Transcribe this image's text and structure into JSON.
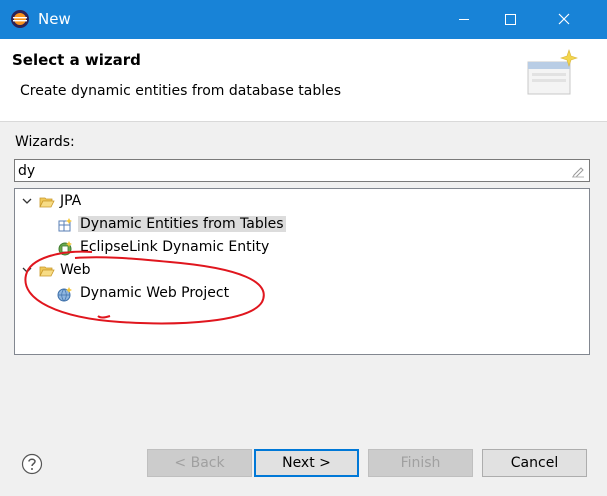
{
  "window": {
    "title": "New",
    "icon": "eclipse-icon"
  },
  "header": {
    "title": "Select a wizard",
    "description": "Create dynamic entities from database tables",
    "banner_icon": "wizard-banner-icon"
  },
  "filter": {
    "label": "Wizards:",
    "value": "dy",
    "clear_icon": "clear-filter-icon"
  },
  "tree": {
    "groups": [
      {
        "label": "JPA",
        "expanded": true,
        "icon": "folder-open-icon",
        "items": [
          {
            "label": "Dynamic Entities from Tables",
            "icon": "entity-table-icon",
            "selected": true
          },
          {
            "label": "EclipseLink Dynamic Entity",
            "icon": "eclipselink-entity-icon",
            "selected": false
          }
        ]
      },
      {
        "label": "Web",
        "expanded": true,
        "icon": "folder-open-icon",
        "items": [
          {
            "label": "Dynamic Web Project",
            "icon": "web-project-icon",
            "selected": false
          }
        ]
      }
    ]
  },
  "buttons": {
    "back": "< Back",
    "next": "Next >",
    "finish": "Finish",
    "cancel": "Cancel",
    "help_icon": "help-icon"
  },
  "colors": {
    "titlebar": "#1883d7",
    "annotation": "#e0161e",
    "default_button_border": "#0078d7"
  }
}
